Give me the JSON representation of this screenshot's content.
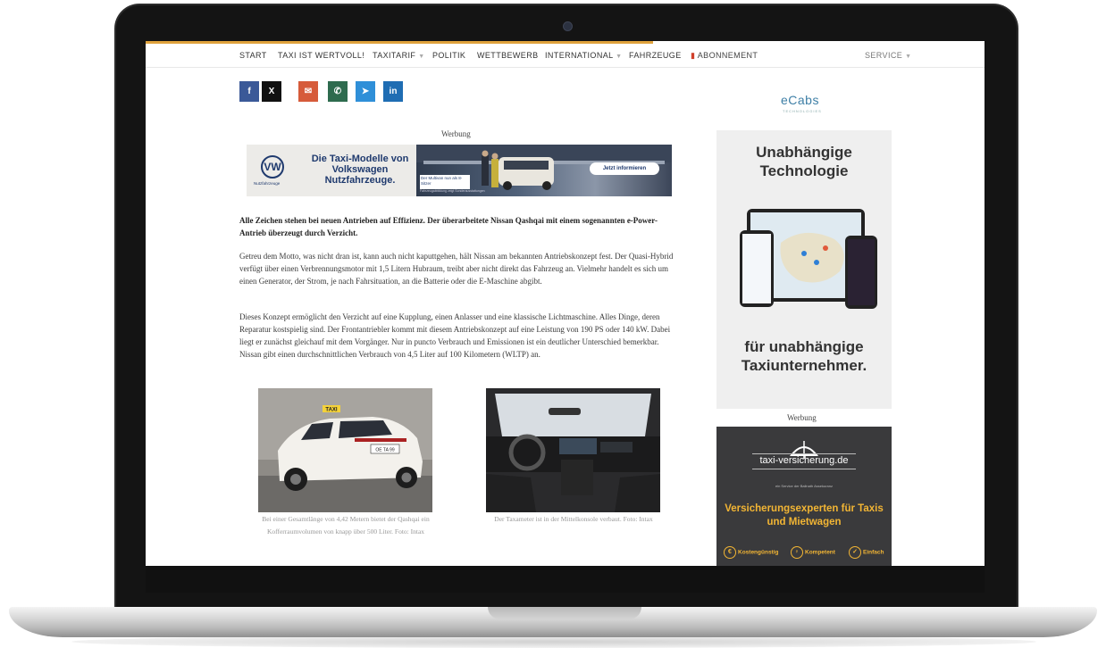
{
  "nav": {
    "items": [
      "START",
      "TAXI IST WERTVOLL!",
      "TAXITARIF",
      "POLITIK",
      "WETTBEWERB",
      "INTERNATIONAL",
      "FAHRZEUGE",
      "ABONNEMENT",
      "SERVICE"
    ]
  },
  "share": {
    "facebook": "f",
    "x": "X",
    "email": "✉",
    "whatsapp": "✆",
    "telegram": "➤",
    "linkedin": "in"
  },
  "ad_label": "Werbung",
  "vw_ad": {
    "headline": "Die Taxi-Modelle von Volkswagen Nutzfahrzeuge.",
    "logo": "VW",
    "logo_sub": "Nutzfahrzeuge",
    "cta": "Jetzt informieren",
    "small_box": "Der Multivan nun als 8-Sitzer",
    "tiny": "Fahrzeugabbildung zeigt Sonderausstattungen"
  },
  "article": {
    "lead": "Alle Zeichen stehen bei neuen Antrieben auf Effizienz. Der überarbeitete Nissan Qashqai mit einem sogenannten e-Power-Antrieb überzeugt durch Verzicht.",
    "p1": "Getreu dem Motto, was nicht dran ist, kann auch nicht kaputtgehen, hält Nissan am bekannten Antriebskonzept fest. Der Quasi-Hybrid verfügt über einen Verbrennungsmotor mit 1,5 Litern Hubraum, treibt aber nicht direkt das Fahrzeug an. Vielmehr handelt es sich um einen Generator, der Strom, je nach Fahrsituation, an die Batterie oder die E-Maschine abgibt.",
    "p2": "Dieses Konzept ermöglicht den Verzicht auf eine Kupplung, einen Anlasser und eine klassische Lichtmaschine. Alles Dinge, deren Reparatur kostspielig sind. Der Frontantriebler kommt mit diesem Antriebskonzept auf eine Leistung von 190 PS oder 140 kW. Dabei liegt er zunächst gleichauf mit dem Vorgänger. Nur in puncto Verbrauch und Emissionen ist ein deutlicher Unterschied bemerkbar. Nissan gibt einen durchschnittlichen Verbrauch von 4,5 Liter auf 100 Kilometern (WLTP) an.",
    "caption1": "Bei einer Gesamtlänge von 4,42 Metern bietet der Qashqai ein Kofferraumvolumen von knapp über 500 Liter. Foto: Intax",
    "caption2": "Der Taxameter ist in der Mittelkonsole verbaut. Foto: Intax",
    "taxi_sign": "TAXI",
    "plate": "OE TA 99"
  },
  "sidebar": {
    "brand": "eCabs",
    "brand_sub": "TECHNOLOGIES",
    "headline1": "Unabhängige Technologie",
    "headline2": "für unabhängige Taxiunternehmer.",
    "ad_label": "Werbung",
    "ins_brand": "taxi-versicherung.de",
    "ins_sub": "ein Service der Ballnath Assekuranz",
    "ins_head": "Versicherungsexperten für Taxis und Mietwagen",
    "ins_features": [
      "Kostengünstig",
      "Kompetent",
      "Einfach"
    ]
  }
}
